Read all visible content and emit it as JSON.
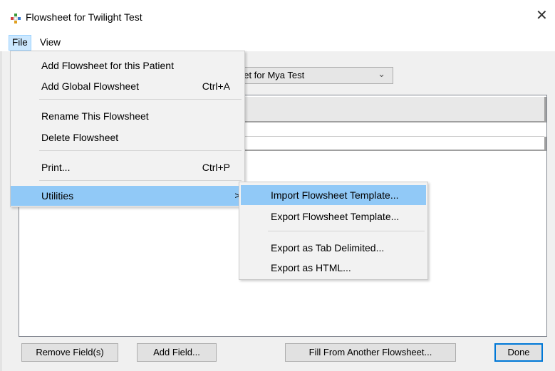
{
  "window": {
    "title": "Flowsheet for Twilight Test",
    "close_glyph": "✕"
  },
  "menubar": {
    "file": "File",
    "view": "View"
  },
  "combo": {
    "visible_text": "eet for Mya Test",
    "arrow": "⌄"
  },
  "buttons": {
    "remove": "Remove Field(s)",
    "add": "Add Field...",
    "fill": "Fill From Another Flowsheet...",
    "done": "Done"
  },
  "file_menu": {
    "add_patient": "Add Flowsheet for this Patient",
    "add_global": "Add Global Flowsheet",
    "add_global_shortcut": "Ctrl+A",
    "rename": "Rename This Flowsheet",
    "delete": "Delete Flowsheet",
    "print": "Print...",
    "print_shortcut": "Ctrl+P",
    "utilities": "Utilities",
    "submenu_arrow": ">"
  },
  "utilities_menu": {
    "import_template": "Import Flowsheet Template...",
    "export_template": "Export Flowsheet Template...",
    "export_tab": "Export as Tab Delimited...",
    "export_html": "Export as HTML..."
  },
  "colors": {
    "highlight": "#91c9f7",
    "menu_bg": "#f2f2f2",
    "dialog_bg": "#f0f0f0",
    "default_button_border": "#0078d7"
  },
  "icons": {
    "app": "flowsheet-app-icon",
    "close": "close-icon"
  }
}
